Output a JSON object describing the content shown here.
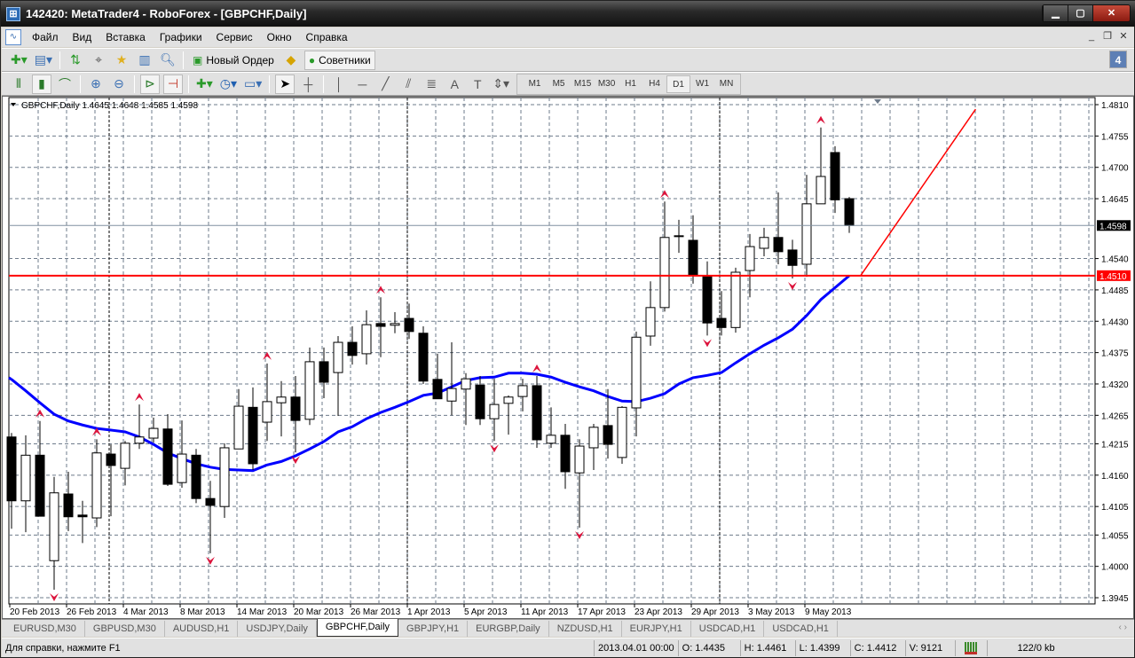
{
  "window": {
    "title": "142420: MetaTrader4 - RoboForex - [GBPCHF,Daily]",
    "app_icon": "metatrader-icon"
  },
  "menu": [
    "Файл",
    "Вид",
    "Вставка",
    "Графики",
    "Сервис",
    "Окно",
    "Справка"
  ],
  "toolbar": {
    "new_order": "Новый Ордер",
    "experts": "Советники",
    "notifications_count": "4"
  },
  "timeframes": [
    "M1",
    "M5",
    "M15",
    "M30",
    "H1",
    "H4",
    "D1",
    "W1",
    "MN"
  ],
  "active_timeframe": "D1",
  "chart": {
    "header": "GBPCHF,Daily  1.4645 1.4648 1.4585 1.4598",
    "bid_label": "1.4598",
    "hline_label": "1.4510"
  },
  "chart_data": {
    "type": "candlestick",
    "symbol": "GBPCHF",
    "period": "Daily",
    "ylim": [
      1.3945,
      1.481
    ],
    "price_ticks": [
      "1.4810",
      "1.4755",
      "1.4700",
      "1.4645",
      "1.4540",
      "1.4485",
      "1.4430",
      "1.4375",
      "1.4320",
      "1.4265",
      "1.4215",
      "1.4160",
      "1.4105",
      "1.4055",
      "1.4000",
      "1.3945"
    ],
    "date_labels": [
      "20 Feb 2013",
      "26 Feb 2013",
      "4 Mar 2013",
      "8 Mar 2013",
      "14 Mar 2013",
      "20 Mar 2013",
      "26 Mar 2013",
      "1 Apr 2013",
      "5 Apr 2013",
      "11 Apr 2013",
      "17 Apr 2013",
      "23 Apr 2013",
      "29 Apr 2013",
      "3 May 2013",
      "9 May 2013"
    ],
    "period_separators": [
      8,
      29,
      51
    ],
    "ohlc": [
      [
        1.4227,
        1.4234,
        1.4066,
        1.4115
      ],
      [
        1.4115,
        1.423,
        1.406,
        1.4195
      ],
      [
        1.4195,
        1.4255,
        1.4088,
        1.4088
      ],
      [
        1.401,
        1.4157,
        1.3959,
        1.4129
      ],
      [
        1.4127,
        1.4166,
        1.4062,
        1.4087
      ],
      [
        1.409,
        1.4115,
        1.4041,
        1.4087
      ],
      [
        1.4085,
        1.4223,
        1.4069,
        1.4199
      ],
      [
        1.4197,
        1.4214,
        1.4088,
        1.4177
      ],
      [
        1.4172,
        1.422,
        1.4142,
        1.4216
      ],
      [
        1.4216,
        1.4284,
        1.4206,
        1.4227
      ],
      [
        1.4225,
        1.4261,
        1.4217,
        1.4242
      ],
      [
        1.4241,
        1.4267,
        1.4141,
        1.4144
      ],
      [
        1.4147,
        1.4256,
        1.4138,
        1.4197
      ],
      [
        1.4195,
        1.4206,
        1.4111,
        1.4119
      ],
      [
        1.4119,
        1.415,
        1.4023,
        1.4107
      ],
      [
        1.4105,
        1.4216,
        1.4085,
        1.4208
      ],
      [
        1.4206,
        1.4311,
        1.4206,
        1.4281
      ],
      [
        1.4279,
        1.4314,
        1.4169,
        1.418
      ],
      [
        1.4253,
        1.4356,
        1.422,
        1.4289
      ],
      [
        1.4287,
        1.4325,
        1.4228,
        1.4297
      ],
      [
        1.4297,
        1.4334,
        1.42,
        1.4256
      ],
      [
        1.4258,
        1.4384,
        1.4248,
        1.4359
      ],
      [
        1.4359,
        1.4384,
        1.4295,
        1.4323
      ],
      [
        1.434,
        1.4404,
        1.4264,
        1.4393
      ],
      [
        1.4393,
        1.4421,
        1.4354,
        1.437
      ],
      [
        1.4373,
        1.4449,
        1.4354,
        1.4424
      ],
      [
        1.4426,
        1.4472,
        1.4367,
        1.4421
      ],
      [
        1.4423,
        1.4446,
        1.4409,
        1.4426
      ],
      [
        1.4435,
        1.4461,
        1.4399,
        1.4412
      ],
      [
        1.4409,
        1.4421,
        1.432,
        1.4325
      ],
      [
        1.4328,
        1.4373,
        1.4294,
        1.4294
      ],
      [
        1.429,
        1.4393,
        1.4265,
        1.4312
      ],
      [
        1.4311,
        1.4339,
        1.4248,
        1.4329
      ],
      [
        1.4318,
        1.4334,
        1.4248,
        1.4259
      ],
      [
        1.4259,
        1.4329,
        1.422,
        1.4284
      ],
      [
        1.4286,
        1.43,
        1.4231,
        1.4297
      ],
      [
        1.4298,
        1.4329,
        1.4272,
        1.4317
      ],
      [
        1.4317,
        1.4334,
        1.4208,
        1.4222
      ],
      [
        1.4216,
        1.4279,
        1.4208,
        1.423
      ],
      [
        1.423,
        1.425,
        1.4136,
        1.4166
      ],
      [
        1.4164,
        1.4223,
        1.4068,
        1.4211
      ],
      [
        1.4208,
        1.425,
        1.4169,
        1.4244
      ],
      [
        1.4247,
        1.4311,
        1.4189,
        1.4214
      ],
      [
        1.4191,
        1.4281,
        1.418,
        1.4279
      ],
      [
        1.4278,
        1.4412,
        1.4228,
        1.4402
      ],
      [
        1.4404,
        1.45,
        1.4387,
        1.4454
      ],
      [
        1.4454,
        1.464,
        1.4447,
        1.4577
      ],
      [
        1.458,
        1.4608,
        1.455,
        1.4579
      ],
      [
        1.4572,
        1.4616,
        1.4496,
        1.451
      ],
      [
        1.451,
        1.4535,
        1.4405,
        1.4427
      ],
      [
        1.4435,
        1.4483,
        1.4405,
        1.4419
      ],
      [
        1.4419,
        1.4524,
        1.441,
        1.4516
      ],
      [
        1.4519,
        1.4583,
        1.4472,
        1.4561
      ],
      [
        1.4558,
        1.4594,
        1.4544,
        1.4577
      ],
      [
        1.4577,
        1.4656,
        1.453,
        1.4552
      ],
      [
        1.4555,
        1.4573,
        1.4505,
        1.4528
      ],
      [
        1.453,
        1.4687,
        1.4508,
        1.4636
      ],
      [
        1.4636,
        1.477,
        1.4636,
        1.4684
      ],
      [
        1.4726,
        1.4737,
        1.462,
        1.4643
      ],
      [
        1.4645,
        1.4648,
        1.4585,
        1.4598
      ]
    ],
    "moving_average": [
      1.4328,
      1.4308,
      1.4287,
      1.4267,
      1.4255,
      1.4248,
      1.4242,
      1.4239,
      1.4236,
      1.4227,
      1.4214,
      1.4199,
      1.4189,
      1.418,
      1.4174,
      1.417,
      1.4169,
      1.4168,
      1.4178,
      1.4184,
      1.4194,
      1.4206,
      1.4219,
      1.4236,
      1.4245,
      1.4259,
      1.427,
      1.4279,
      1.4289,
      1.43,
      1.4304,
      1.4315,
      1.4326,
      1.4331,
      1.4332,
      1.4339,
      1.4339,
      1.4337,
      1.4332,
      1.4323,
      1.4315,
      1.4308,
      1.4298,
      1.429,
      1.4289,
      1.4295,
      1.4303,
      1.432,
      1.4331,
      1.4335,
      1.434,
      1.4357,
      1.4373,
      1.4388,
      1.4401,
      1.4416,
      1.444,
      1.4468,
      1.4489,
      1.451
    ],
    "fractals_up": [
      3,
      7,
      10,
      19,
      27,
      38,
      47,
      58
    ],
    "fractals_down": [
      4,
      15,
      21,
      35,
      41,
      50,
      56
    ],
    "horizontal_line": 1.451,
    "bid": 1.4598,
    "trendline": [
      [
        60.8,
        1.451
      ],
      [
        68.9,
        1.4802
      ]
    ],
    "colors": {
      "ma": "#0000ff",
      "hline": "#ff0000",
      "fractal": "#dc143c",
      "grid": "#6e7b8b"
    }
  },
  "tabs": [
    "EURUSD,M30",
    "GBPUSD,M30",
    "AUDUSD,H1",
    "USDJPY,Daily",
    "GBPCHF,Daily",
    "GBPJPY,H1",
    "EURGBP,Daily",
    "NZDUSD,H1",
    "EURJPY,H1",
    "USDCAD,H1",
    "USDCAD,H1"
  ],
  "active_tab": "GBPCHF,Daily",
  "status": {
    "help": "Для справки, нажмите F1",
    "datetime": "2013.04.01 00:00",
    "open": "O: 1.4435",
    "high": "H: 1.4461",
    "low": "L: 1.4399",
    "close": "C: 1.4412",
    "volume": "V: 9121",
    "traffic": "122/0 kb"
  }
}
